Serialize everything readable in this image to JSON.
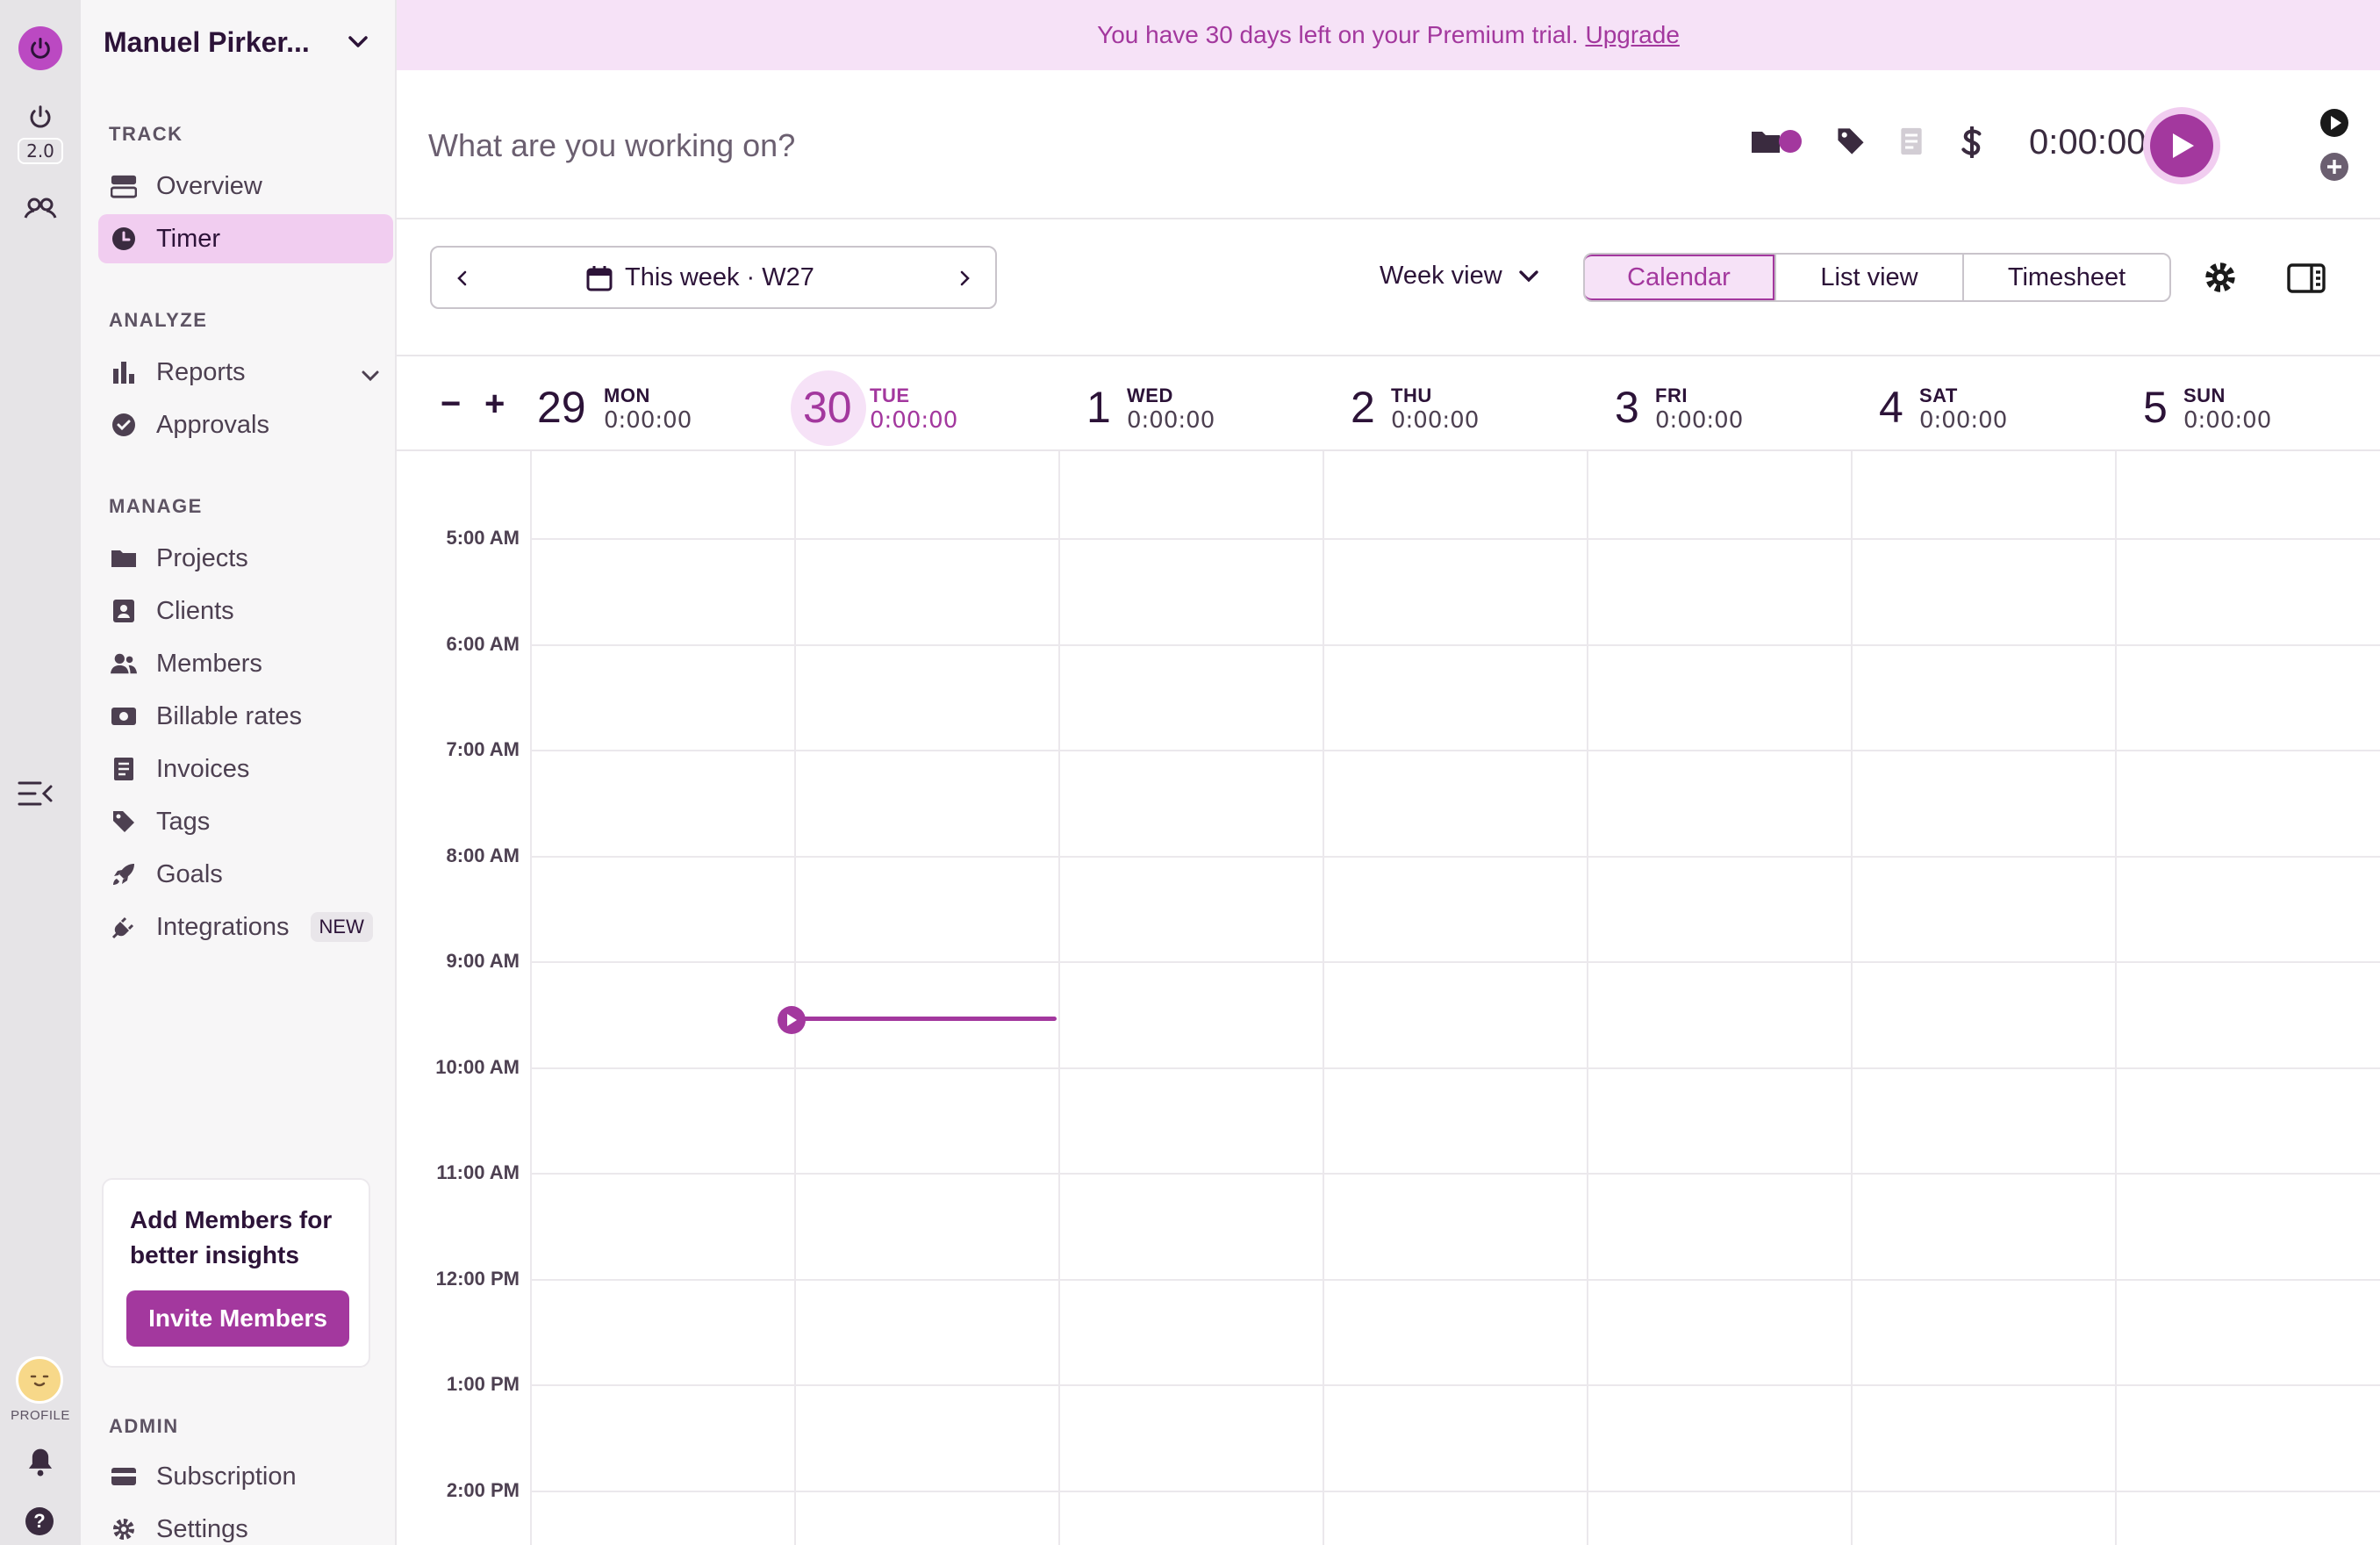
{
  "rail": {
    "version_label": "2.0",
    "profile_label": "PROFILE"
  },
  "sidebar": {
    "workspace_name": "Manuel Pirker...",
    "sections": {
      "track": "TRACK",
      "analyze": "ANALYZE",
      "manage": "MANAGE",
      "admin": "ADMIN"
    },
    "items": {
      "overview": "Overview",
      "timer": "Timer",
      "reports": "Reports",
      "approvals": "Approvals",
      "projects": "Projects",
      "clients": "Clients",
      "members": "Members",
      "billable_rates": "Billable rates",
      "invoices": "Invoices",
      "tags": "Tags",
      "goals": "Goals",
      "integrations": "Integrations",
      "integrations_badge": "NEW",
      "subscription": "Subscription",
      "settings": "Settings"
    },
    "promo": {
      "title": "Add Members for better insights",
      "button": "Invite Members"
    }
  },
  "banner": {
    "text": "You have 30 days left on your Premium trial.",
    "link": "Upgrade"
  },
  "timer": {
    "placeholder": "What are you working on?",
    "value": "0:00:00"
  },
  "toolbar": {
    "week_label": "This week",
    "week_separator": "·",
    "week_number": "W27",
    "view_select": "Week view",
    "tabs": [
      "Calendar",
      "List view",
      "Timesheet"
    ],
    "active_tab": "Calendar"
  },
  "calendar": {
    "days": [
      {
        "num": "29",
        "name": "MON",
        "total": "0:00:00",
        "today": false
      },
      {
        "num": "30",
        "name": "TUE",
        "total": "0:00:00",
        "today": true
      },
      {
        "num": "1",
        "name": "WED",
        "total": "0:00:00",
        "today": false
      },
      {
        "num": "2",
        "name": "THU",
        "total": "0:00:00",
        "today": false
      },
      {
        "num": "3",
        "name": "FRI",
        "total": "0:00:00",
        "today": false
      },
      {
        "num": "4",
        "name": "SAT",
        "total": "0:00:00",
        "today": false
      },
      {
        "num": "5",
        "name": "SUN",
        "total": "0:00:00",
        "today": false
      }
    ],
    "hours": [
      "5:00 AM",
      "6:00 AM",
      "7:00 AM",
      "8:00 AM",
      "9:00 AM",
      "10:00 AM",
      "11:00 AM",
      "12:00 PM",
      "1:00 PM",
      "2:00 PM"
    ]
  },
  "colors": {
    "accent": "#a3389e",
    "accent_light": "#f6e2f7",
    "active_nav": "#f1cdf0"
  }
}
